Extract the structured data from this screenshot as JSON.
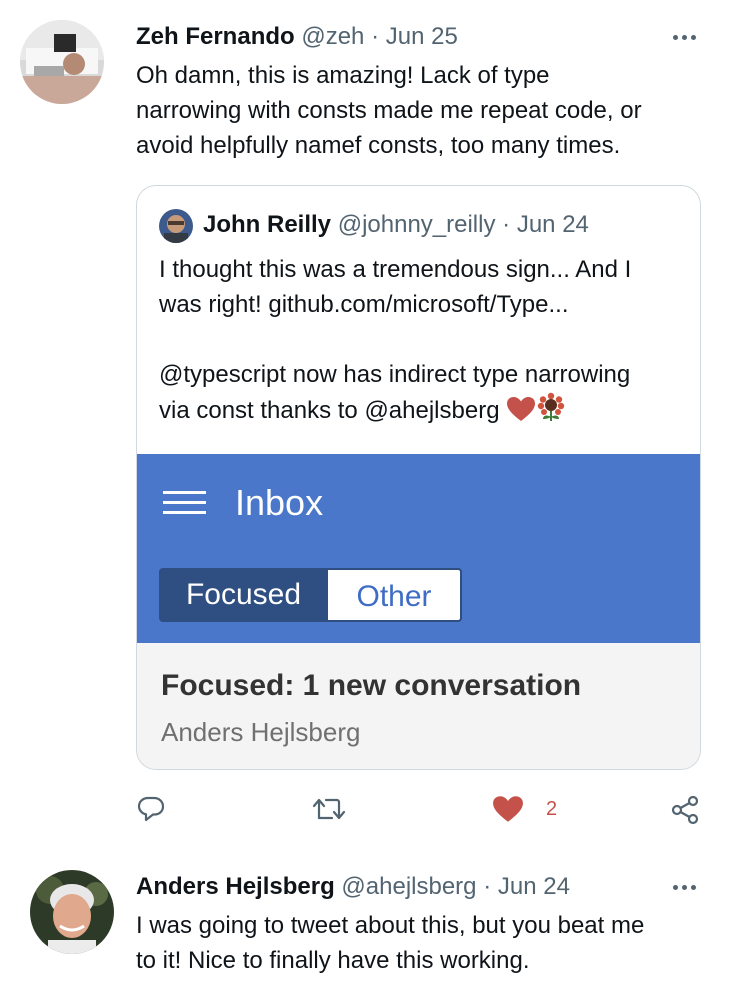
{
  "tweets": [
    {
      "name": "Zeh Fernando",
      "handle": "@zeh",
      "separator": "·",
      "date": "Jun 25",
      "text_lines": [
        "Oh damn, this is amazing! Lack of type",
        "narrowing with consts made me repeat code, or",
        "avoid helpfully namef consts, too many times."
      ],
      "quote": {
        "name": "John Reilly",
        "handle": "@johnny_reilly",
        "separator": "·",
        "date": "Jun 24",
        "lines": [
          "I thought this was a tremendous sign... And I",
          "was right! github.com/microsoft/Type...",
          "@typescript now has indirect type narrowing",
          "via const thanks to @ahejlsberg"
        ],
        "emojis": [
          "heart-emoji",
          "sunflower-emoji"
        ],
        "media": {
          "title": "Inbox",
          "tab_focused": "Focused",
          "tab_other": "Other",
          "summary": "Focused: 1 new conversation",
          "sender": "Anders Hejlsberg"
        }
      },
      "actions": {
        "reply_icon": "reply-icon",
        "retweet_icon": "retweet-icon",
        "like_icon": "heart-icon",
        "like_count": "2",
        "share_icon": "share-icon"
      }
    },
    {
      "name": "Anders Hejlsberg",
      "handle": "@ahejlsberg",
      "separator": "·",
      "date": "Jun 24",
      "text_lines": [
        "I was going to tweet about this, but you beat me",
        "to it! Nice to finally have this working."
      ]
    }
  ],
  "colors": {
    "secondary_text": "#536471",
    "like_red": "#c5524a",
    "media_blue": "#4a77c9"
  }
}
